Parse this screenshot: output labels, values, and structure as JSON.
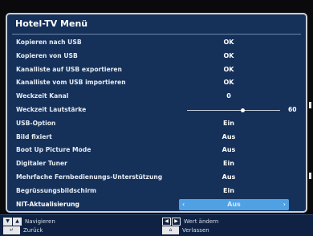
{
  "menu": {
    "title": "Hotel-TV Menü",
    "rows": [
      {
        "label": "Kopieren nach USB",
        "value": "OK"
      },
      {
        "label": "Kopieren von USB",
        "value": "OK"
      },
      {
        "label": "Kanalliste auf USB exportieren",
        "value": "OK"
      },
      {
        "label": "Kanalliste vom USB importieren",
        "value": "OK"
      },
      {
        "label": "Weckzeit Kanal",
        "value": "0"
      },
      {
        "label": "Weckzeit Lautstärke",
        "value": "60",
        "slider_fraction": 0.6
      },
      {
        "label": "USB-Option",
        "value": "Ein"
      },
      {
        "label": "Bild fixiert",
        "value": "Aus"
      },
      {
        "label": "Boot Up Picture Mode",
        "value": "Aus"
      },
      {
        "label": "Digitaler Tuner",
        "value": "Ein"
      },
      {
        "label": "Mehrfache Fernbedienungs-Unterstützung",
        "value": "Aus"
      },
      {
        "label": "Begrüssungsbildschirm",
        "value": "Ein"
      },
      {
        "label": "NIT-Aktualisierung",
        "value": "Aus",
        "selected": true
      }
    ],
    "selected_arrows": {
      "left": "‹",
      "right": "›"
    }
  },
  "footer": {
    "navigate": "Navigieren",
    "back": "Zurück",
    "change_value": "Wert ändern",
    "exit": "Verlassen"
  },
  "colors": {
    "panel_bg": "#15315a",
    "panel_border": "#c9cfd8",
    "selection": "#4fa1e4",
    "footer_bg": "#0f2243"
  },
  "icons": {
    "navigate": "up-down-arrow-keys-icon",
    "back": "back-return-icon",
    "change_value": "left-right-arrow-keys-icon",
    "exit": "home-icon"
  }
}
